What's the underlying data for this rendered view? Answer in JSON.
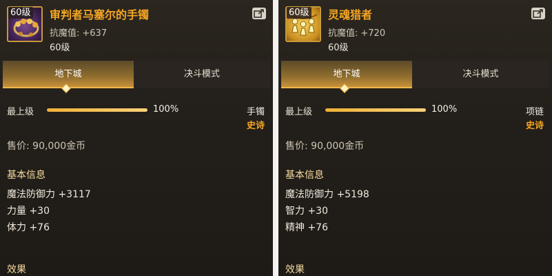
{
  "items": [
    {
      "level_badge": "60级",
      "name": "审判者马塞尔的手镯",
      "resist_label": "抗魔值:",
      "resist_value": "+637",
      "req_level": "60级",
      "tabs": [
        "地下城",
        "决斗模式"
      ],
      "top_label": "最上级",
      "progress_pct": "100%",
      "progress_fraction": 1.0,
      "slot": "手镯",
      "rarity": "史诗",
      "price": "售价: 90,000金币",
      "basic_info_title": "基本信息",
      "attributes": [
        "魔法防御力 +3117",
        "力量 +30",
        "体力 +76"
      ],
      "effect_title": "效果",
      "icon": "bracelet-icon"
    },
    {
      "level_badge": "60级",
      "name": "灵魂猎者",
      "resist_label": "抗魔值:",
      "resist_value": "+720",
      "req_level": "60级",
      "tabs": [
        "地下城",
        "决斗模式"
      ],
      "top_label": "最上级",
      "progress_pct": "100%",
      "progress_fraction": 1.0,
      "slot": "项链",
      "rarity": "史诗",
      "price": "售价: 90,000金币",
      "basic_info_title": "基本信息",
      "attributes": [
        "魔法防御力 +5198",
        "智力 +30",
        "精神 +76"
      ],
      "effect_title": "效果",
      "icon": "necklace-icon"
    }
  ],
  "colors": {
    "item_name": "#f5a623",
    "rarity_epic": "#f5a623",
    "progress": "#f0b138",
    "active_tab": "#c8923a"
  }
}
